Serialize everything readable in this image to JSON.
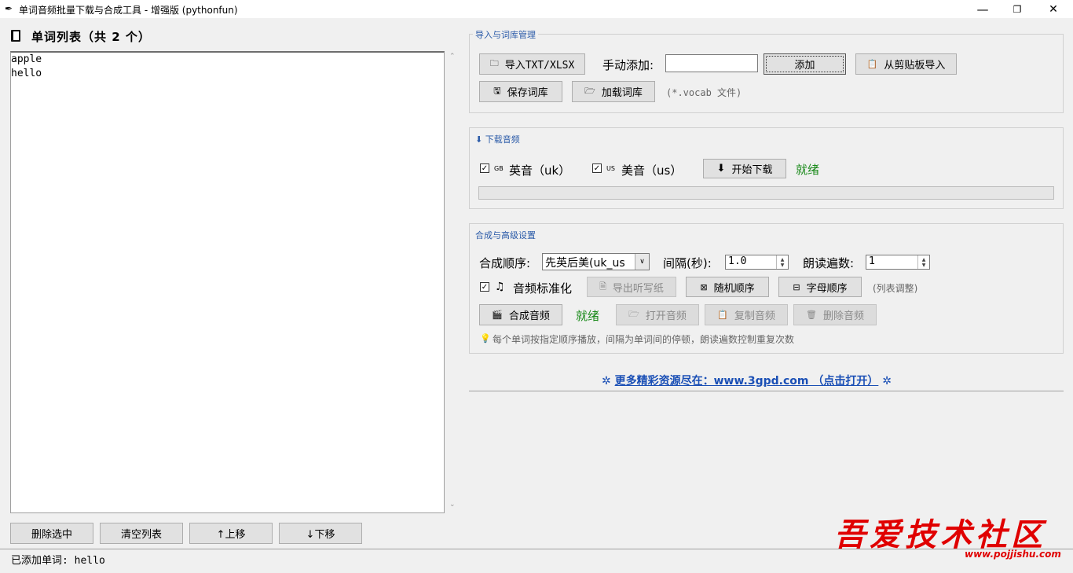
{
  "window": {
    "title": "单词音频批量下载与合成工具 - 增强版 (pythonfun)",
    "minimize": "—",
    "maximize": "❐",
    "close": "✕"
  },
  "left": {
    "list_title": "单词列表（共 2 个）",
    "words": [
      "apple",
      "hello"
    ],
    "buttons": {
      "delete_selected": "删除选中",
      "clear_list": "清空列表",
      "move_up": "↑上移",
      "move_down": "↓下移"
    }
  },
  "import_group": {
    "title": "导入与词库管理",
    "import_button": "导入TXT/XLSX",
    "manual_add_label": "手动添加:",
    "manual_add_value": "",
    "add_button": "添加",
    "clipboard_button": "从剪贴板导入",
    "save_vocab_button": "保存词库",
    "load_vocab_button": "加载词库",
    "vocab_hint": "(*.vocab 文件)"
  },
  "download_group": {
    "title": "下载音频",
    "uk_prefix": "GB",
    "uk_label": "英音（uk）",
    "us_prefix": "US",
    "us_label": "美音（us）",
    "start_button": "开始下载",
    "status": "就绪",
    "progress": 0
  },
  "synth_group": {
    "title": "合成与高级设置",
    "order_label": "合成顺序:",
    "order_value": "先英后美(uk_us",
    "interval_label": "间隔(秒):",
    "interval_value": "1.0",
    "repeat_label": "朗读遍数:",
    "repeat_value": "1",
    "normalize_label": "音频标准化",
    "export_dictation_button": "导出听写纸",
    "random_order_button": "随机顺序",
    "alpha_order_button": "字母顺序",
    "list_adjust_hint": "(列表调整)",
    "synth_button": "合成音频",
    "synth_status": "就绪",
    "open_audio_button": "打开音频",
    "copy_audio_button": "复制音频",
    "delete_audio_button": "删除音频",
    "tip": "每个单词按指定顺序播放，间隔为单词间的停顿，朗读遍数控制重复次数"
  },
  "footer_link": "更多精彩资源尽在：www.3gpd.com （点击打开）",
  "status_bar": "已添加单词: hello",
  "watermark": {
    "text": "吾爱技术社区",
    "url": "www.pojjishu.com"
  },
  "colors": {
    "link": "#1a4fb5",
    "ready_green": "#1a8a1a",
    "group_title": "#2a5aa8",
    "watermark": "#e00000"
  }
}
